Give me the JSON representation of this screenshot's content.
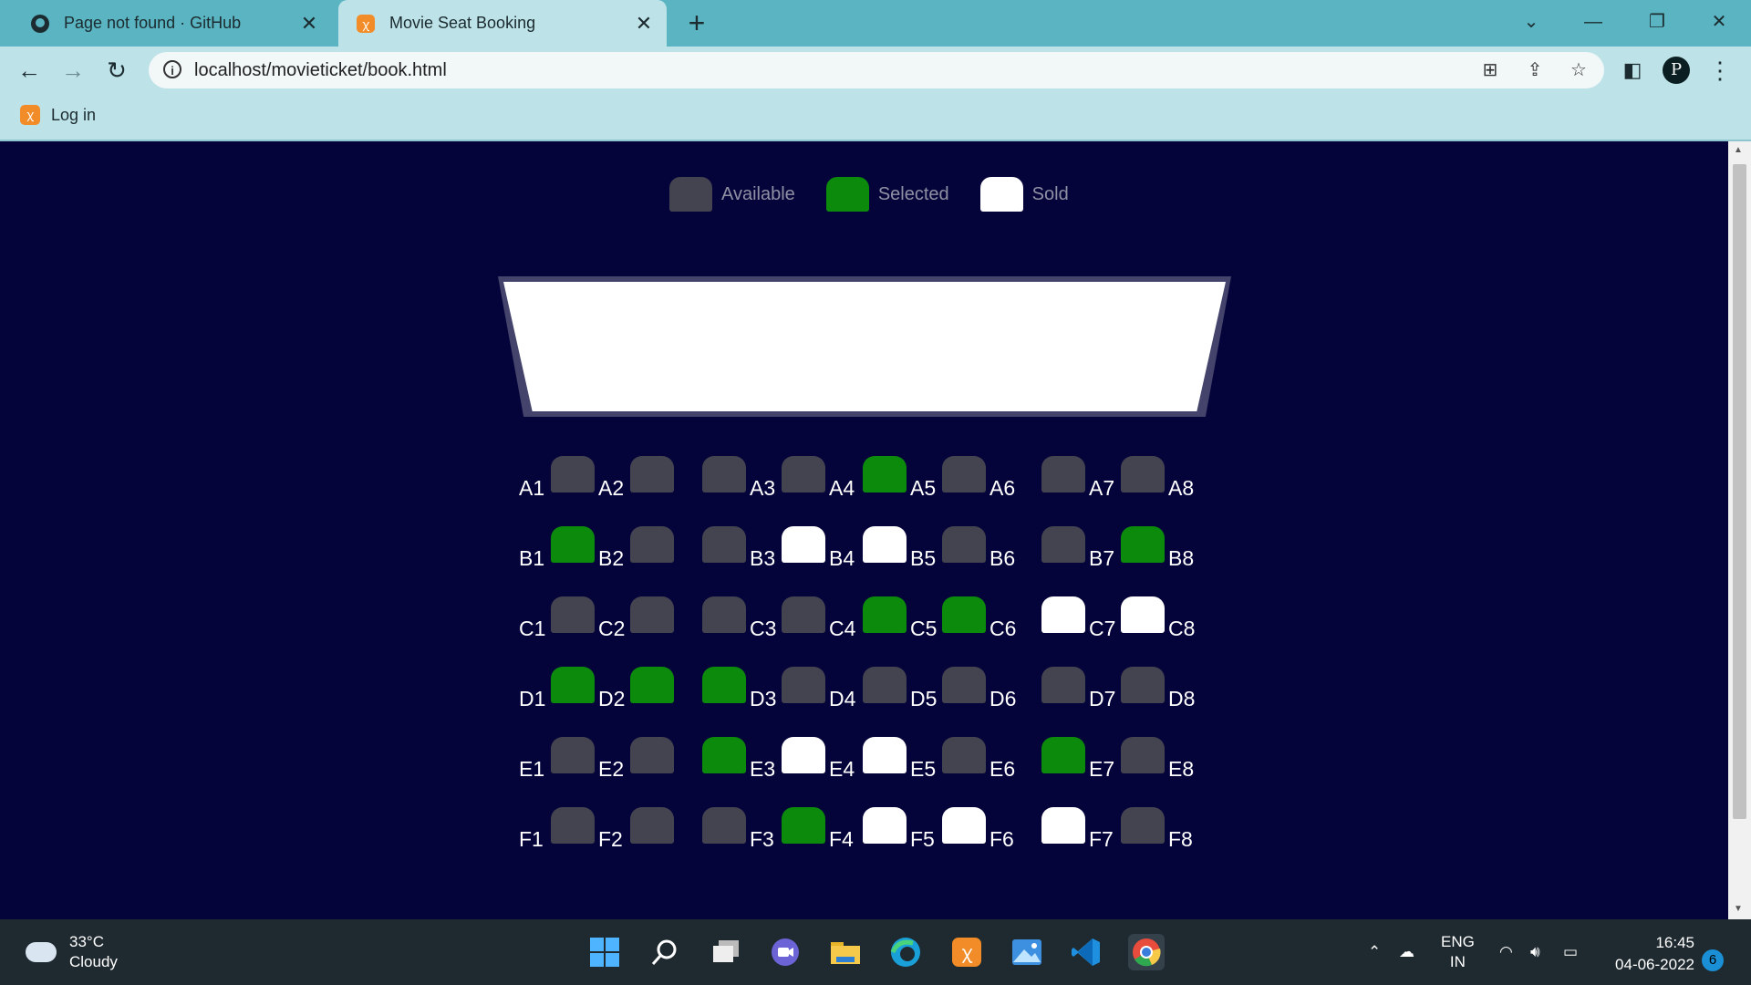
{
  "browser": {
    "tabs": [
      {
        "title": "Page not found · GitHub",
        "icon": "github-icon",
        "active": false
      },
      {
        "title": "Movie Seat Booking",
        "icon": "xampp-icon",
        "active": true
      }
    ],
    "url": "localhost/movieticket/book.html",
    "bookmarks": [
      {
        "label": "Log in",
        "icon": "xampp-icon"
      }
    ],
    "profile_initial": "P"
  },
  "legend": [
    {
      "label": "Available",
      "status": "available"
    },
    {
      "label": "Selected",
      "status": "selected"
    },
    {
      "label": "Sold",
      "status": "sold"
    }
  ],
  "colors": {
    "background": "#05043a",
    "available": "#444451",
    "selected": "#0b8a0b",
    "sold": "#ffffff",
    "screen": "#ffffff"
  },
  "seat_rows": [
    {
      "row": "A",
      "labels": [
        "A1",
        "A2",
        "A3",
        "A4",
        "A5",
        "A6",
        "A7",
        "A8"
      ],
      "status": [
        "available",
        "available",
        "available",
        "available",
        "selected",
        "available",
        "available",
        "available"
      ]
    },
    {
      "row": "B",
      "labels": [
        "B1",
        "B2",
        "B3",
        "B4",
        "B5",
        "B6",
        "B7",
        "B8"
      ],
      "status": [
        "selected",
        "available",
        "available",
        "sold",
        "sold",
        "available",
        "available",
        "selected"
      ]
    },
    {
      "row": "C",
      "labels": [
        "C1",
        "C2",
        "C3",
        "C4",
        "C5",
        "C6",
        "C7",
        "C8"
      ],
      "status": [
        "available",
        "available",
        "available",
        "available",
        "selected",
        "selected",
        "sold",
        "sold"
      ]
    },
    {
      "row": "D",
      "labels": [
        "D1",
        "D2",
        "D3",
        "D4",
        "D5",
        "D6",
        "D7",
        "D8"
      ],
      "status": [
        "selected",
        "selected",
        "selected",
        "available",
        "available",
        "available",
        "available",
        "available"
      ]
    },
    {
      "row": "E",
      "labels": [
        "E1",
        "E2",
        "E3",
        "E4",
        "E5",
        "E6",
        "E7",
        "E8"
      ],
      "status": [
        "available",
        "available",
        "selected",
        "sold",
        "sold",
        "available",
        "selected",
        "available"
      ]
    },
    {
      "row": "F",
      "labels": [
        "F1",
        "F2",
        "F3",
        "F4",
        "F5",
        "F6",
        "F7",
        "F8"
      ],
      "status": [
        "available",
        "available",
        "available",
        "selected",
        "sold",
        "sold",
        "sold",
        "available"
      ]
    }
  ],
  "taskbar": {
    "weather_temp": "33°C",
    "weather_desc": "Cloudy",
    "lang_line1": "ENG",
    "lang_line2": "IN",
    "time": "16:45",
    "date": "04-06-2022",
    "notifications": "6"
  }
}
